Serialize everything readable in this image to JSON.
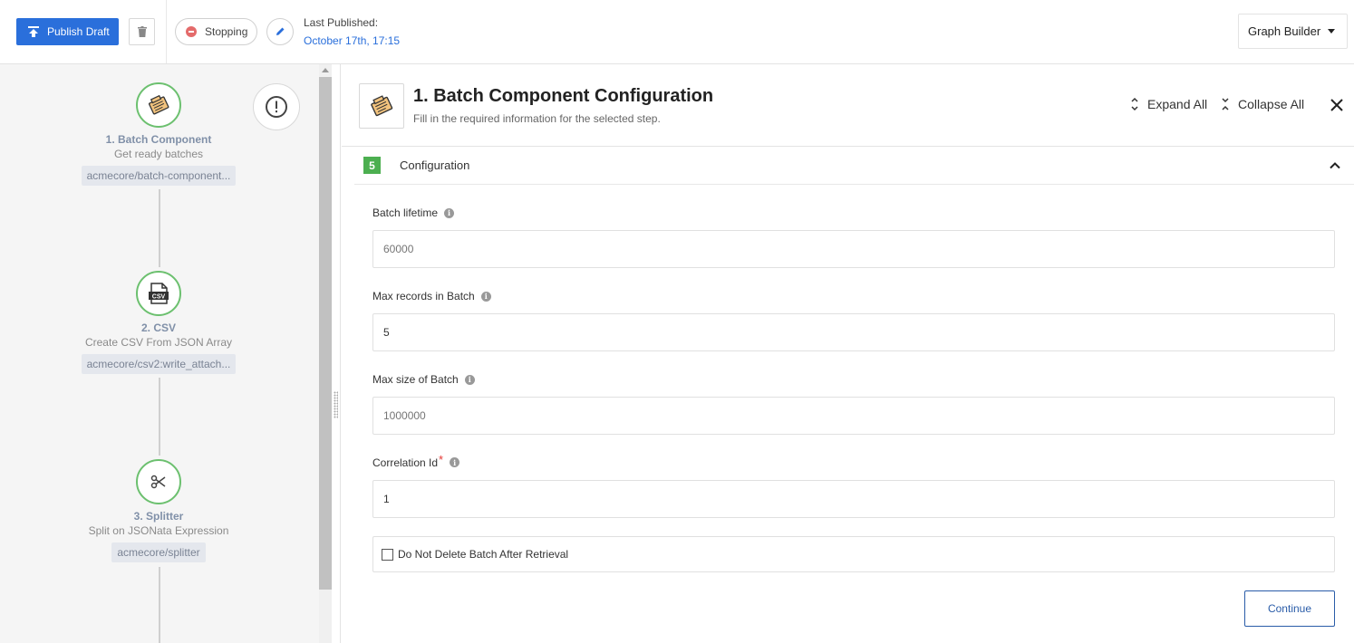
{
  "toolbar": {
    "publish_label": "Publish Draft",
    "status_label": "Stopping",
    "last_published_label": "Last Published:",
    "last_published_date": "October 17th, 17:15",
    "view_selector": "Graph Builder"
  },
  "flow": {
    "nodes": [
      {
        "title": "1. Batch Component",
        "subtitle": "Get ready batches",
        "tag": "acmecore/batch-component...",
        "icon": "batch-icon"
      },
      {
        "title": "2. CSV",
        "subtitle": "Create CSV From JSON Array",
        "tag": "acmecore/csv2:write_attach...",
        "icon": "csv-icon"
      },
      {
        "title": "3. Splitter",
        "subtitle": "Split on JSONata Expression",
        "tag": "acmecore/splitter",
        "icon": "scissors-icon"
      }
    ]
  },
  "panel": {
    "title": "1. Batch Component Configuration",
    "subtitle": "Fill in the required information for the selected step.",
    "expand_all": "Expand All",
    "collapse_all": "Collapse All",
    "section": {
      "step_number": "5",
      "label": "Configuration"
    },
    "fields": {
      "batch_lifetime": {
        "label": "Batch lifetime",
        "placeholder": "60000",
        "value": ""
      },
      "max_records": {
        "label": "Max records in Batch",
        "value": "5"
      },
      "max_size": {
        "label": "Max size of Batch",
        "placeholder": "1000000",
        "value": ""
      },
      "correlation_id": {
        "label": "Correlation Id",
        "required_mark": "*",
        "value": "1"
      }
    },
    "checkbox_label": "Do Not Delete Batch After Retrieval",
    "checkbox_checked": false,
    "continue_label": "Continue"
  },
  "colors": {
    "primary": "#2a6fdb",
    "success": "#4caf50",
    "danger": "#e46b6b"
  }
}
